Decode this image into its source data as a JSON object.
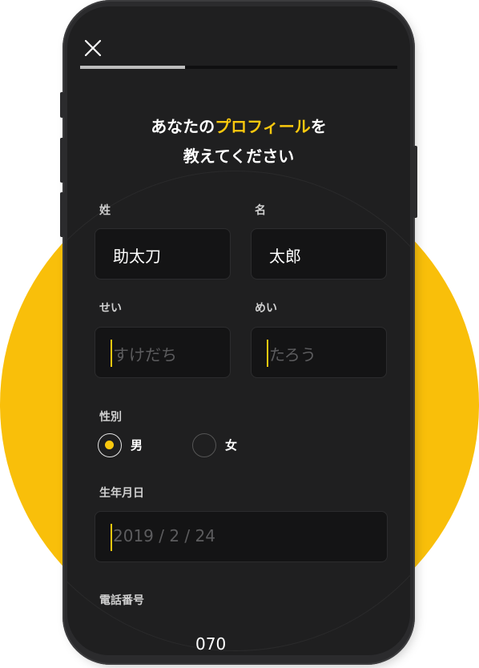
{
  "header": {
    "close_icon": "close-icon",
    "progress_fraction": 0.33
  },
  "title": {
    "line1_pre": "あなたの",
    "line1_highlight": "プロフィール",
    "line1_post": "を",
    "line2": "教えてください"
  },
  "form": {
    "last_name": {
      "label": "姓",
      "value": "助太刀"
    },
    "first_name": {
      "label": "名",
      "value": "太郎"
    },
    "last_name_kana": {
      "label": "せい",
      "placeholder": "すけだち"
    },
    "first_name_kana": {
      "label": "めい",
      "placeholder": "たろう"
    },
    "gender": {
      "label": "性別",
      "options": [
        {
          "label": "男",
          "selected": true
        },
        {
          "label": "女",
          "selected": false
        }
      ]
    },
    "birthday": {
      "label": "生年月日",
      "placeholder": "2019 / 2 / 24"
    },
    "phone": {
      "label": "電話番号",
      "value": "070"
    }
  },
  "colors": {
    "accent": "#f9c80e",
    "background_circle": "#f9bf0a",
    "screen": "#1f1f20",
    "field": "#141415"
  }
}
